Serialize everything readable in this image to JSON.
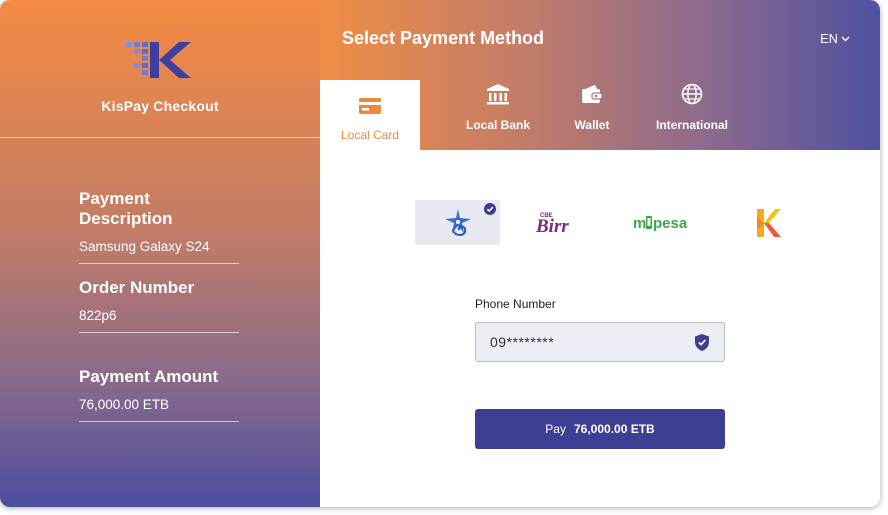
{
  "brand": {
    "name": "KisPay Checkout",
    "colors": {
      "orange": "#f58a43",
      "indigo": "#3d3f95"
    }
  },
  "order": {
    "description_label": "Payment Description",
    "description_value": "Samsung Galaxy S24",
    "order_number_label": "Order Number",
    "order_number_value": "822p6",
    "amount_label": "Payment Amount",
    "amount_value": "76,000.00 ETB"
  },
  "header": {
    "title": "Select Payment Method",
    "language": "EN"
  },
  "tabs": [
    {
      "label": "Local Card",
      "icon": "card-icon",
      "active": true
    },
    {
      "label": "Local Bank",
      "icon": "bank-icon",
      "active": false
    },
    {
      "label": "Wallet",
      "icon": "wallet-icon",
      "active": false
    },
    {
      "label": "International",
      "icon": "globe-icon",
      "active": false
    }
  ],
  "providers": [
    {
      "name": "telebirr",
      "icon": "telebirr-logo",
      "selected": true
    },
    {
      "name": "cbe birr",
      "icon": "cbe-birr-logo",
      "logo_small": "CBE",
      "logo_text": "Birr",
      "selected": false
    },
    {
      "name": "m-pesa",
      "icon": "mpesa-logo",
      "logo_text_m": "m",
      "logo_text_rest": "pesa",
      "selected": false
    },
    {
      "name": "kacha",
      "icon": "kacha-logo",
      "selected": false
    }
  ],
  "form": {
    "phone_label": "Phone Number",
    "phone_value": "09********"
  },
  "pay_button": {
    "label": "Pay",
    "amount": "76,000.00 ETB"
  }
}
